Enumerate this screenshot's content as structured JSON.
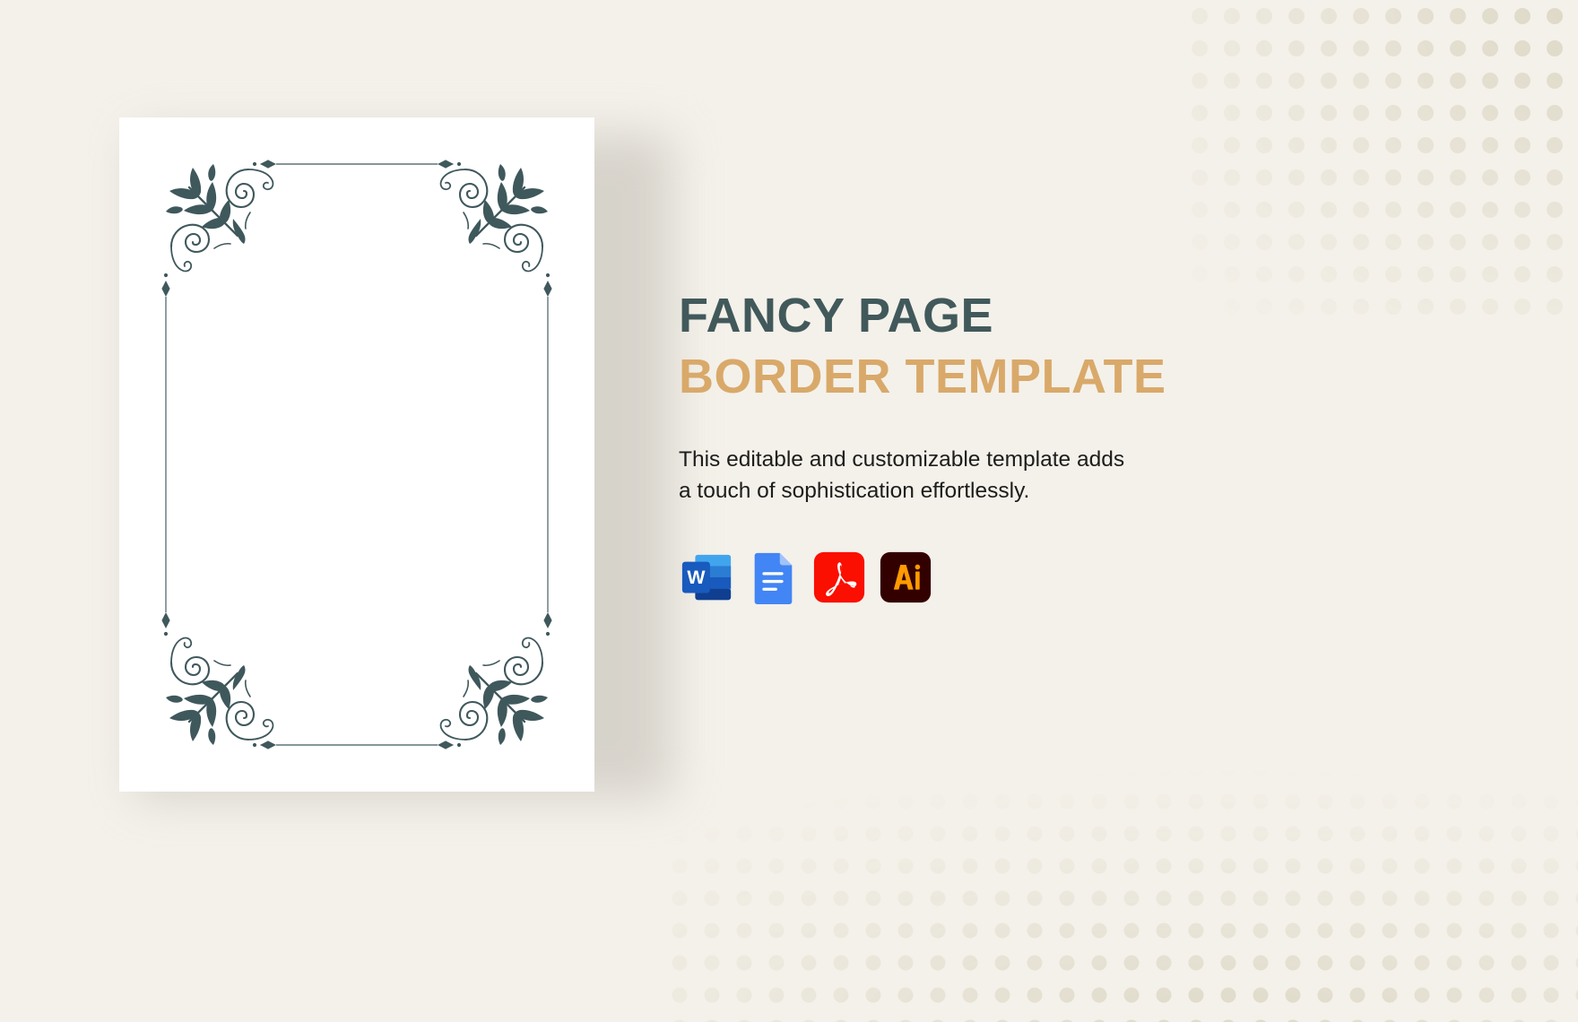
{
  "document": {
    "background_color": "#f4f1ea",
    "paper_color": "#ffffff"
  },
  "preview": {
    "name": "fancy-page-border-preview",
    "ornament_color": "#3f585c",
    "ornament_style": "victorian-floral-corner-flourish",
    "border_description": "Decorative vintage floral corner ornaments joined by thin rules with diamond finials"
  },
  "content": {
    "title_line1": "FANCY PAGE",
    "title_line2": "BORDER TEMPLATE",
    "title_line1_color": "#42595b",
    "title_line2_color": "#d9a96a",
    "description": "This editable and customizable template adds a touch of sophistication effortlessly.",
    "description_color": "#1d1d1b"
  },
  "formats": [
    {
      "id": "word",
      "label": "Word",
      "icon": "ms-word-icon",
      "color": "#185ABD"
    },
    {
      "id": "google-docs",
      "label": "Google Docs",
      "icon": "google-docs-icon",
      "color": "#4285F4"
    },
    {
      "id": "pdf",
      "label": "PDF",
      "icon": "adobe-pdf-icon",
      "color": "#FA0F00"
    },
    {
      "id": "illustrator",
      "label": "Illustrator",
      "icon": "adobe-illustrator-icon",
      "color": "#330000",
      "glyph": "Ai",
      "glyph_color": "#FF9A00"
    }
  ],
  "decoration": {
    "halftone_dot_color": "#e2ddcd",
    "halftone_top_right": "halftone-dot-pattern",
    "halftone_bottom_right": "halftone-dot-pattern"
  }
}
